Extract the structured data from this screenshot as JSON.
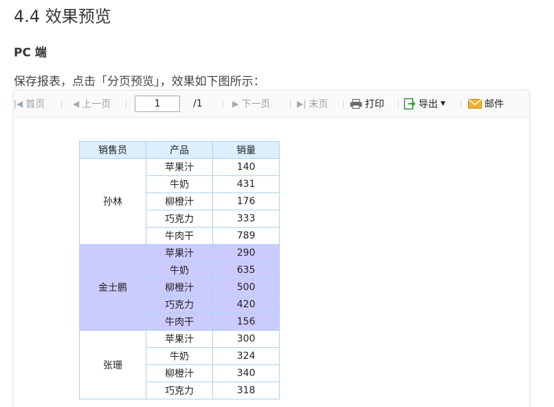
{
  "heading": "4.4 效果预览",
  "subheading": "PC 端",
  "paragraph": "保存报表，点击「分页预览」，效果如下图所示：",
  "toolbar": {
    "first_page": "首页",
    "prev_page": "上一页",
    "page_input": "1",
    "page_total": "/1",
    "next_page": "下一页",
    "last_page": "末页",
    "print": "打印",
    "export": "导出",
    "mail": "邮件"
  },
  "table": {
    "headers": [
      "销售员",
      "产品",
      "销量"
    ],
    "groups": [
      {
        "salesperson": "孙林",
        "highlighted": false,
        "rows": [
          {
            "product": "苹果汁",
            "sales": "140"
          },
          {
            "product": "牛奶",
            "sales": "431"
          },
          {
            "product": "柳橙汁",
            "sales": "176"
          },
          {
            "product": "巧克力",
            "sales": "333"
          },
          {
            "product": "牛肉干",
            "sales": "789"
          }
        ]
      },
      {
        "salesperson": "金士鹏",
        "highlighted": true,
        "rows": [
          {
            "product": "苹果汁",
            "sales": "290"
          },
          {
            "product": "牛奶",
            "sales": "635"
          },
          {
            "product": "柳橙汁",
            "sales": "500"
          },
          {
            "product": "巧克力",
            "sales": "420"
          },
          {
            "product": "牛肉干",
            "sales": "156"
          }
        ]
      },
      {
        "salesperson": "张珊",
        "highlighted": false,
        "rows": [
          {
            "product": "苹果汁",
            "sales": "300"
          },
          {
            "product": "牛奶",
            "sales": "324"
          },
          {
            "product": "柳橙汁",
            "sales": "340"
          },
          {
            "product": "巧克力",
            "sales": "318"
          }
        ]
      }
    ]
  },
  "colors": {
    "header_bg": "#dcefff",
    "highlight_bg": "#cccbfd",
    "border": "#a8d4ee"
  }
}
